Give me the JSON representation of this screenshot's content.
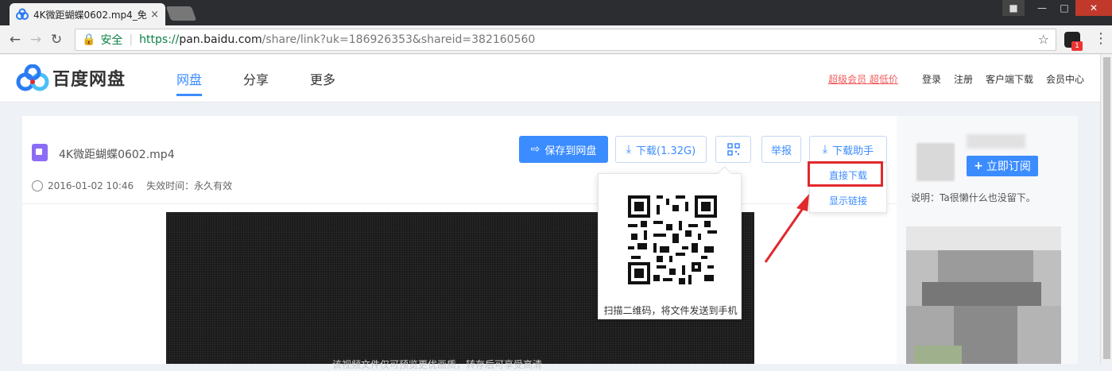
{
  "browser": {
    "tab_title": "4K微距蝴蝶0602.mp4_免",
    "tab_close": "×",
    "secure_label": "安全",
    "url_https": "https://",
    "url_host": "pan.baidu.com",
    "url_path": "/share/link?uk=186926353&shareid=382160560",
    "ext_badge": "1"
  },
  "header": {
    "logo_text": "百度网盘",
    "nav": [
      "网盘",
      "分享",
      "更多"
    ],
    "vip_link": "超级会员 超低价",
    "links": [
      "登录",
      "注册",
      "客户端下载",
      "会员中心"
    ]
  },
  "file": {
    "name": "4K微距蝴蝶0602.mp4",
    "date": "2016-01-02 10:46",
    "expiry": "失效时间：永久有效"
  },
  "toolbar": {
    "save_label": "保存到网盘",
    "download_label": "下载(1.32G)",
    "report_label": "举报",
    "helper_label": "下载助手"
  },
  "download_menu": {
    "direct": "直接下载",
    "show_link": "显示链接"
  },
  "qr_popup": {
    "text": "扫描二维码，将文件发送到手机"
  },
  "video": {
    "caption": "该视频文件仅可预览更优画质，转存后可享受高清"
  },
  "sidebar": {
    "subscribe_label": "立即订阅",
    "bio": "说明：Ta很懒什么也没留下。"
  },
  "colors": {
    "accent": "#3b8cff",
    "highlight": "#e2282d",
    "vip": "#f25a5a"
  }
}
